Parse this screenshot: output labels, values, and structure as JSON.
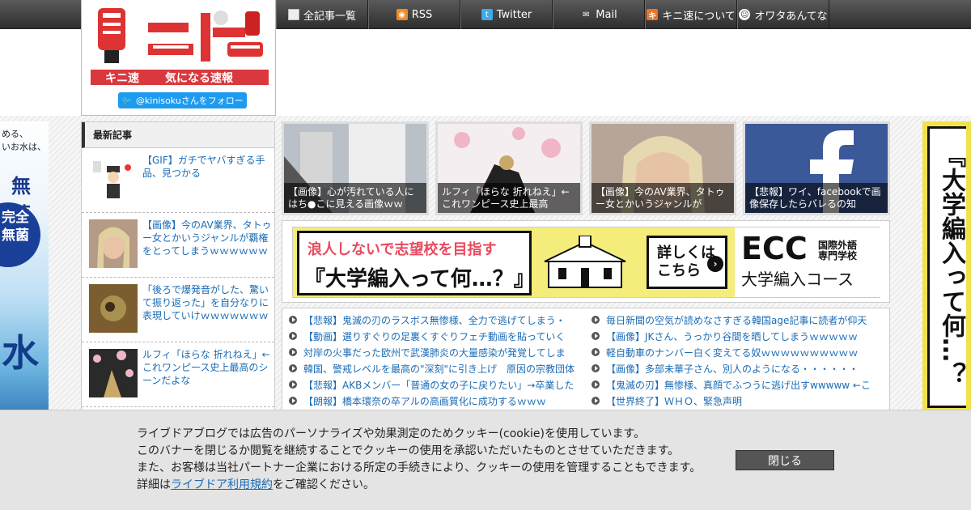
{
  "nav": {
    "items": [
      {
        "label": "全記事一覧",
        "icon": "list-icon"
      },
      {
        "label": "RSS",
        "icon": "rss-icon"
      },
      {
        "label": "Twitter",
        "icon": "twitter-icon"
      },
      {
        "label": "Mail",
        "icon": "mail-icon"
      },
      {
        "label": "キニ速について",
        "icon": "kini-icon"
      },
      {
        "label": "オワタあんてな",
        "icon": "owata-icon"
      }
    ]
  },
  "logo": {
    "site_name": "キニ速",
    "tagline": "気になる速報",
    "follow_label": "@kinisokuさんをフォロー"
  },
  "sidebar": {
    "heading": "最新記事",
    "items": [
      {
        "title": "【GIF】ガチでヤバすぎる手品、見つかる"
      },
      {
        "title": "【画像】今のAV業界、タトゥー女とかいうジャンルが覇権をとってしまうｗｗｗｗｗｗ"
      },
      {
        "title": "「後ろで爆発音がした、驚いて振り返った」を自分なりに表現していけｗｗｗｗｗｗｗ"
      },
      {
        "title": "ルフィ「ほらな 折れねえ」←これワンピース史上最高のシーンだよな"
      }
    ]
  },
  "featured": [
    {
      "caption": "【画像】心が汚れている人にはち●こに見える画像ｗｗ"
    },
    {
      "caption": "ルフィ「ほらな 折れねえ」←これワンピース史上最高"
    },
    {
      "caption": "【画像】今のAV業界、タトゥー女とかいうジャンルが"
    },
    {
      "caption": "【悲報】ワイ、facebookで画像保存したらバレるの知"
    }
  ],
  "ad": {
    "headline": "浪人しないで志望校を目指す",
    "main": "『大学編入って何…？』",
    "button_line1": "詳しくは",
    "button_line2": "こちら",
    "brand": "ECC",
    "brand_sub1": "国際外語",
    "brand_sub2": "専門学校",
    "course": "大学編入コース"
  },
  "links": {
    "left": [
      "【悲報】鬼滅の刃のラスボス無惨様、全力で逃げてしまう・",
      "【動画】選りすぐりの足裏くすぐりフェチ動画を貼っていく",
      "対岸の火事だった欧州で武漢肺炎の大量感染が発覚してしま",
      "韓国、警戒レベルを最高の\"深刻\"に引き上げ　原因の宗教団体",
      "【悲報】AKBメンバー「普通の女の子に戻りたい」→卒業した",
      "【朗報】橋本環奈の卒アルの高画質化に成功するｗｗｗ"
    ],
    "right": [
      "毎日新聞の空気が読めなさすぎる韓国age記事に読者が仰天",
      "【画像】JKさん、うっかり谷間を晒してしまうｗｗｗｗｗ",
      "軽自動車のナンバー白く変えてる奴ｗｗｗｗｗｗｗｗｗｗ",
      "【画像】多部未華子さん、別人のようになる・・・・・・",
      "【鬼滅の刃】無惨様、真顔でふつうに逃げ出すwwwww ←こ",
      "【世界終了】ＷＨＯ、緊急声明"
    ]
  },
  "left_ad": {
    "line1": "める、",
    "line2": "いお水は、",
    "big": "無菌",
    "circle1": "完全",
    "circle2": "無菌",
    "water": "水"
  },
  "right_ad": {
    "text": "『大学編入って何…？"
  },
  "cookie": {
    "line1": "ライブドアブログでは広告のパーソナライズや効果測定のためクッキー(cookie)を使用しています。",
    "line2": "このバナーを閉じるか閲覧を継続することでクッキーの使用を承認いただいたものとさせていただきます。",
    "line3": "また、お客様は当社パートナー企業における所定の手続きにより、クッキーの使用を管理することもできます。",
    "line4_prefix": "詳細は",
    "link_text": "ライブドア利用規約",
    "line4_suffix": "をご確認ください。",
    "close_label": "閉じる"
  },
  "colors": {
    "nav_bg": "#3a3a3a",
    "link": "#1a6bb5",
    "logo_red": "#d9393e",
    "twitter_blue": "#1d9bf0",
    "cookie_bg": "#e4e4e4"
  }
}
